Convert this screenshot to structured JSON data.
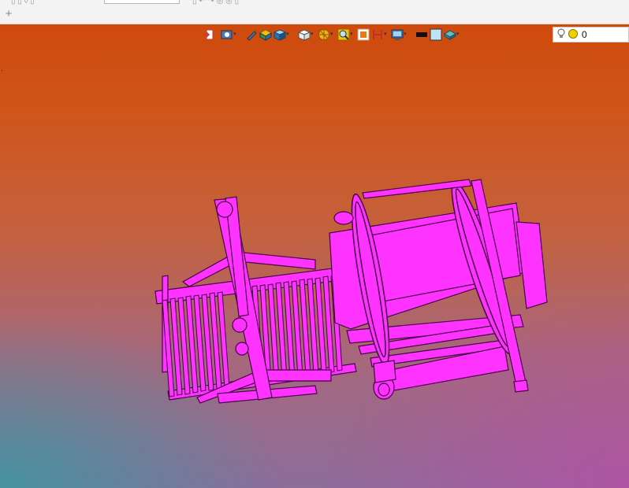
{
  "tabs": {
    "add_symbol": "+"
  },
  "view_toolbar": {
    "buttons": [
      {
        "icon": "exit-view-icon",
        "dropdown": false
      },
      {
        "icon": "view-manager-icon",
        "dropdown": true
      },
      {
        "icon": "pencil-icon",
        "dropdown": false
      },
      {
        "icon": "shading-icon",
        "dropdown": false
      },
      {
        "icon": "display-style-icon",
        "dropdown": true
      },
      {
        "icon": "saved-views-icon",
        "dropdown": true
      },
      {
        "icon": "section-icon",
        "dropdown": true
      },
      {
        "icon": "zoom-icon",
        "dropdown": true
      },
      {
        "icon": "refit-icon",
        "dropdown": false
      },
      {
        "icon": "datum-display-icon",
        "dropdown": true
      },
      {
        "icon": "annotation-display-icon",
        "dropdown": true
      },
      {
        "icon": "color-black-swatch-icon",
        "dropdown": false
      },
      {
        "icon": "color-light-swatch-icon",
        "dropdown": false
      },
      {
        "icon": "appearance-icon",
        "dropdown": true
      }
    ]
  },
  "lighting": {
    "value": "0"
  },
  "colors": {
    "model": "#ff33ff",
    "model_edge": "#4a004a",
    "accent": "#f2a900"
  }
}
